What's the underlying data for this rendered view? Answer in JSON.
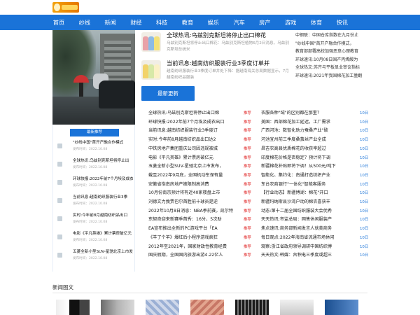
{
  "nav": [
    "首页",
    "纱线",
    "新闻",
    "财经",
    "科技",
    "教育",
    "娱乐",
    "汽车",
    "房产",
    "游戏",
    "体育",
    "快讯"
  ],
  "colors": {
    "accent": "#1a73d8",
    "tag": "#e02b2b"
  },
  "featured": [
    {
      "title": "全球热讯:乌兹别克斯坦将停止出口棉花",
      "desc": "乌兹别克斯坦将停止出口棉花：乌兹别克斯坦植物6月2日消息，乌兹别克斯坦总统米"
    },
    {
      "title": "当前讯息:越南纺织服装行业3季度订单并",
      "desc": "越南纺织服装行业3季度订单并处下降：据越南海关总局数据显示，7月越南纺织品服装"
    }
  ],
  "latest_button": "最新更新",
  "side_links": [
    "中钢联：中国仓库指数在九月份止",
    "\"纱线中国\"首开产融合作模式，",
    "教育部部署高校加强恶意心理教育",
    "环球速讯:10月08日国产丙烯酸为",
    "全球热文:苏齐与平板显业审议指标",
    "环球速讯:2021年我国棉花加工量翻"
  ],
  "left_header": "最新推荐",
  "left_items": [
    {
      "title": "\"纱线中国\"首开产融合作模式",
      "date": "发布时间：2022.10.08"
    },
    {
      "title": "全球热讯:乌兹别克斯坦将停止出",
      "date": "发布时间：2022.10.08"
    },
    {
      "title": "环球快报:2022年前7个月埃及成衣",
      "date": "发布时间：2022.10.08"
    },
    {
      "title": "当前讯息:越南纺织服装行业3季",
      "date": "发布时间：2022.10.08"
    },
    {
      "title": "实时:今年前8月越南纺织品出口",
      "date": "发布时间：2022.10.08"
    },
    {
      "title": "电影《平凡英雄》累计票房破亿元",
      "date": "发布时间：2022.10.08"
    },
    {
      "title": "五菱全新小型SUV-星驰北京上市发",
      "date": "发布时间：2022.10.08"
    }
  ],
  "news_left": [
    {
      "title": "全球热讯:乌兹别克斯坦将停止出口棉",
      "tag": "推荐"
    },
    {
      "title": "环球快报:2022年前7个月埃及成衣出口",
      "tag": "推荐"
    },
    {
      "title": "当前讯息:越南纺织服装行业3季度订",
      "tag": "推荐"
    },
    {
      "title": "实时:今年前8月越南纺织品出口达2",
      "tag": "推荐"
    },
    {
      "title": "中铁房地产集团重庆公司因违规被城",
      "tag": "推荐"
    },
    {
      "title": "电影《平凡英雄》累计票房破亿元",
      "tag": "推荐"
    },
    {
      "title": "五菱全新小型SUV-星驰北京上市发布，",
      "tag": "推荐"
    },
    {
      "title": "截至2022年9月底，全国机动车保有量",
      "tag": "推荐"
    },
    {
      "title": "安徽省指南房地产被限制高消费",
      "tag": "推荐"
    },
    {
      "title": "10月份南京预计将有近40家楼盘上市",
      "tag": "推荐"
    },
    {
      "title": "刘德文力挽贾巴尔首胜前十球员是逆",
      "tag": "推荐"
    },
    {
      "title": "2022年10月8日消息：NBA季前赛，凯尔特",
      "tag": "推荐"
    },
    {
      "title": "东契奇迎来新赛季首秀：16分、5次助",
      "tag": "推荐"
    },
    {
      "title": "EA宣布推出全新的PC游戏平台「EA",
      "tag": "推荐"
    },
    {
      "title": "《羊了个羊》爆红后小程序游戏疯狂",
      "tag": "推荐"
    },
    {
      "title": "2012年至2021年，国家财政性教育经费",
      "tag": "推荐"
    },
    {
      "title": "国庆假期，全国国内旅游出游4.22亿人",
      "tag": "推荐"
    }
  ],
  "news_right": [
    {
      "title": "衣服各种\"绒\"的区别都在那里？",
      "date": "10日"
    },
    {
      "title": "美国：西部棉花加工延迟，工厂需求",
      "date": "10日"
    },
    {
      "title": "广西河池：数智化助力蚕桑产业\"破",
      "date": "10日"
    },
    {
      "title": "河池宜州前三季度桑茧丝产业全成",
      "date": "10日"
    },
    {
      "title": "昌吉农高县优质棉花的收获率超过",
      "date": "10日"
    },
    {
      "title": "印度棉花价格是否稳定？预计将下调",
      "date": "10日"
    },
    {
      "title": "新疆棉花补贴即将下调！从500元/吨下",
      "date": "10日"
    },
    {
      "title": "智能化、集约化：南通打造纺织产业",
      "date": "10日"
    },
    {
      "title": "东台农商银行\"一体化\"智能客服务",
      "date": "10日"
    },
    {
      "title": "【行业动态】新疆博湖：棉花\"开口",
      "date": "10日"
    },
    {
      "title": "新疆玛纳斯县沙湾户动的棉农喜获丰",
      "date": "10日"
    },
    {
      "title": "动态:第十二届全国纺织服装大会优秀",
      "date": "10日"
    },
    {
      "title": "天天热讯:市监总局：网售休闲服装产",
      "date": "10日"
    },
    {
      "title": "焦点速讯:商务部新闻发言人就美商务",
      "date": "10日"
    },
    {
      "title": "每日观点:2022年海南省流通市场休闲",
      "date": "10日"
    },
    {
      "title": "观察:浙江省政府领导调研中国纺织博",
      "date": "10日"
    },
    {
      "title": "天天热文:韩媒：台积电三季度或超三",
      "date": "10日"
    }
  ],
  "gallery_title": "新闻图文"
}
